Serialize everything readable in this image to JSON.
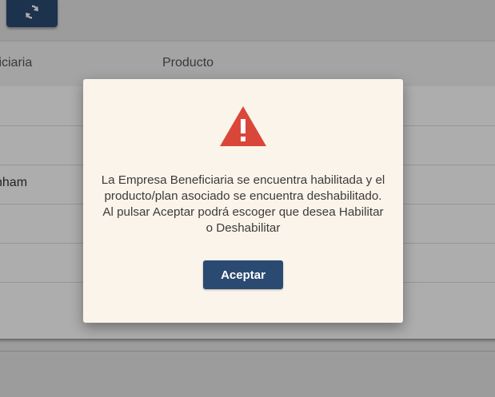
{
  "toolbar": {
    "refresh_icon": "refresh-icon"
  },
  "table": {
    "columns": [
      "ficiaria",
      "Producto"
    ],
    "rows": [
      {
        "beneficiaria": "-",
        "producto": ""
      },
      {
        "beneficiaria": "",
        "producto": ""
      },
      {
        "beneficiaria": "nham",
        "producto": ""
      },
      {
        "beneficiaria": "",
        "producto": ""
      },
      {
        "beneficiaria": "",
        "producto": ""
      },
      {
        "beneficiaria": "",
        "producto": ""
      }
    ]
  },
  "dialog": {
    "icon": "warning-icon",
    "message": "La Empresa Beneficiaria se encuentra habilitada y el producto/plan asociado se encuentra deshabilitado. Al pulsar Aceptar podrá escoger que desea Habilitar o Deshabilitar",
    "accept_label": "Aceptar"
  },
  "colors": {
    "primary": "#2b4a72",
    "warning": "#d9473a",
    "dialog_bg": "#fbf4ea"
  }
}
